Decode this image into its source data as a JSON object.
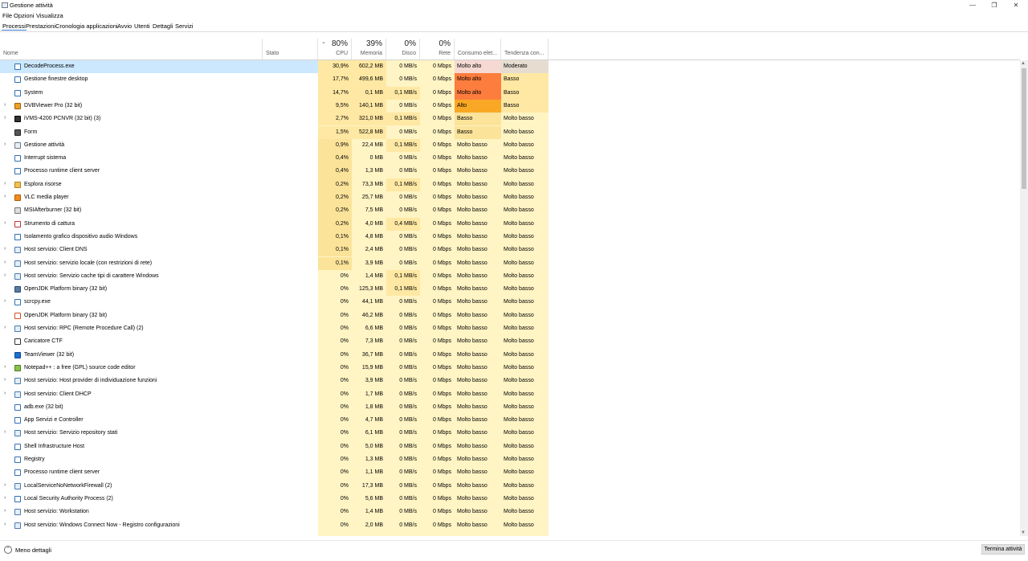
{
  "window": {
    "title": "Gestione attività",
    "minimize": "—",
    "restore": "❐",
    "close": "✕"
  },
  "menu": [
    "File",
    "Opzioni",
    "Visualizza"
  ],
  "tabs": [
    "Processi",
    "Prestazioni",
    "Cronologia applicazioni",
    "Avvio",
    "Utenti",
    "Dettagli",
    "Servizi"
  ],
  "active_tab": "Processi",
  "header": {
    "name": "Nome",
    "status": "Stato",
    "cpu": {
      "pct": "80%",
      "label": "CPU"
    },
    "memory": {
      "pct": "39%",
      "label": "Memoria"
    },
    "disk": {
      "pct": "0%",
      "label": "Disco"
    },
    "network": {
      "pct": "0%",
      "label": "Rete"
    },
    "power": "Consumo elet...",
    "trend": "Tendenza con..."
  },
  "colors": {
    "selected": "#cce8ff",
    "heat_light": "#fff4c4",
    "heat_mid": "#ffe8a3",
    "heat_hi": "#fd7d3e",
    "heat_alto": "#f9a825",
    "heat_trend": "#fbe39a",
    "moderato": "#e6ddd0"
  },
  "processes": [
    {
      "name": "DecodeProcess.exe",
      "expand": false,
      "icon": "app-window-icon",
      "cpu": "30,9%",
      "mem": "602,2 MB",
      "disk": "0 MB/s",
      "net": "0 Mbps",
      "power": "Molto alto",
      "trend": "Moderato"
    },
    {
      "name": "Gestione finestre desktop",
      "expand": false,
      "icon": "app-window-icon",
      "cpu": "17,7%",
      "mem": "499,6 MB",
      "disk": "0 MB/s",
      "net": "0 Mbps",
      "power": "Molto alto",
      "trend": "Basso"
    },
    {
      "name": "System",
      "expand": false,
      "icon": "app-window-icon",
      "cpu": "14,7%",
      "mem": "0,1 MB",
      "disk": "0,1 MB/s",
      "net": "0 Mbps",
      "power": "Molto alto",
      "trend": "Basso"
    },
    {
      "name": "DVBViewer Pro (32 bit)",
      "expand": true,
      "icon": "dvbviewer-icon",
      "cpu": "9,5%",
      "mem": "140,1 MB",
      "disk": "0 MB/s",
      "net": "0 Mbps",
      "power": "Alto",
      "trend": "Basso"
    },
    {
      "name": "iVMS-4200 PCNVR (32 bit) (3)",
      "expand": true,
      "icon": "camera-icon",
      "cpu": "2,7%",
      "mem": "321,0 MB",
      "disk": "0,1 MB/s",
      "net": "0 Mbps",
      "power": "Basso",
      "trend": "Molto basso"
    },
    {
      "name": "Form",
      "expand": false,
      "icon": "form-icon",
      "cpu": "1,5%",
      "mem": "522,8 MB",
      "disk": "0 MB/s",
      "net": "0 Mbps",
      "power": "Basso",
      "trend": "Molto basso"
    },
    {
      "name": "Gestione attività",
      "expand": true,
      "icon": "task-manager-icon",
      "cpu": "0,9%",
      "mem": "22,4 MB",
      "disk": "0,1 MB/s",
      "net": "0 Mbps",
      "power": "Molto basso",
      "trend": "Molto basso"
    },
    {
      "name": "Interrupt sistema",
      "expand": false,
      "icon": "app-window-icon",
      "cpu": "0,4%",
      "mem": "0 MB",
      "disk": "0 MB/s",
      "net": "0 Mbps",
      "power": "Molto basso",
      "trend": "Molto basso"
    },
    {
      "name": "Processo runtime client server",
      "expand": false,
      "icon": "app-window-icon",
      "cpu": "0,4%",
      "mem": "1,3 MB",
      "disk": "0 MB/s",
      "net": "0 Mbps",
      "power": "Molto basso",
      "trend": "Molto basso"
    },
    {
      "name": "Esplora risorse",
      "expand": true,
      "icon": "folder-icon",
      "cpu": "0,2%",
      "mem": "73,3 MB",
      "disk": "0,1 MB/s",
      "net": "0 Mbps",
      "power": "Molto basso",
      "trend": "Molto basso"
    },
    {
      "name": "VLC media player",
      "expand": true,
      "icon": "vlc-cone-icon",
      "cpu": "0,2%",
      "mem": "25,7 MB",
      "disk": "0 MB/s",
      "net": "0 Mbps",
      "power": "Molto basso",
      "trend": "Molto basso"
    },
    {
      "name": "MSIAfterburner (32 bit)",
      "expand": false,
      "icon": "afterburner-icon",
      "cpu": "0,2%",
      "mem": "7,5 MB",
      "disk": "0 MB/s",
      "net": "0 Mbps",
      "power": "Molto basso",
      "trend": "Molto basso"
    },
    {
      "name": "Strumento di cattura",
      "expand": true,
      "icon": "snipping-tool-icon",
      "cpu": "0,2%",
      "mem": "4,0 MB",
      "disk": "0,4 MB/s",
      "net": "0 Mbps",
      "power": "Molto basso",
      "trend": "Molto basso"
    },
    {
      "name": "Isolamento grafico dispositivo audio Windows",
      "expand": false,
      "icon": "app-window-icon",
      "cpu": "0,1%",
      "mem": "4,8 MB",
      "disk": "0 MB/s",
      "net": "0 Mbps",
      "power": "Molto basso",
      "trend": "Molto basso"
    },
    {
      "name": "Host servizio: Client DNS",
      "expand": true,
      "icon": "service-gear-icon",
      "cpu": "0,1%",
      "mem": "2,4 MB",
      "disk": "0 MB/s",
      "net": "0 Mbps",
      "power": "Molto basso",
      "trend": "Molto basso"
    },
    {
      "name": "Host servizio: servizio locale (con restrizioni di rete)",
      "expand": true,
      "icon": "service-gear-icon",
      "cpu": "0,1%",
      "mem": "3,9 MB",
      "disk": "0 MB/s",
      "net": "0 Mbps",
      "power": "Molto basso",
      "trend": "Molto basso"
    },
    {
      "name": "Host servizio: Servizio cache tipi di carattere Windows",
      "expand": true,
      "icon": "service-gear-icon",
      "cpu": "0%",
      "mem": "1,4 MB",
      "disk": "0,1 MB/s",
      "net": "0 Mbps",
      "power": "Molto basso",
      "trend": "Molto basso"
    },
    {
      "name": "OpenJDK Platform binary (32 bit)",
      "expand": false,
      "icon": "java-icon",
      "cpu": "0%",
      "mem": "125,3 MB",
      "disk": "0,1 MB/s",
      "net": "0 Mbps",
      "power": "Molto basso",
      "trend": "Molto basso"
    },
    {
      "name": "scrcpy.exe",
      "expand": true,
      "icon": "app-window-icon",
      "cpu": "0%",
      "mem": "44,1 MB",
      "disk": "0 MB/s",
      "net": "0 Mbps",
      "power": "Molto basso",
      "trend": "Molto basso"
    },
    {
      "name": "OpenJDK Platform binary (32 bit)",
      "expand": false,
      "icon": "java-cup-icon",
      "cpu": "0%",
      "mem": "46,2 MB",
      "disk": "0 MB/s",
      "net": "0 Mbps",
      "power": "Molto basso",
      "trend": "Molto basso"
    },
    {
      "name": "Host servizio: RPC (Remote Procedure Call) (2)",
      "expand": true,
      "icon": "service-gear-icon",
      "cpu": "0%",
      "mem": "6,6 MB",
      "disk": "0 MB/s",
      "net": "0 Mbps",
      "power": "Molto basso",
      "trend": "Molto basso"
    },
    {
      "name": "Caricatore CTF",
      "expand": false,
      "icon": "ctf-pen-icon",
      "cpu": "0%",
      "mem": "7,3 MB",
      "disk": "0 MB/s",
      "net": "0 Mbps",
      "power": "Molto basso",
      "trend": "Molto basso"
    },
    {
      "name": "TeamViewer (32 bit)",
      "expand": false,
      "icon": "teamviewer-icon",
      "cpu": "0%",
      "mem": "36,7 MB",
      "disk": "0 MB/s",
      "net": "0 Mbps",
      "power": "Molto basso",
      "trend": "Molto basso"
    },
    {
      "name": "Notepad++ : a free (GPL) source code editor",
      "expand": true,
      "icon": "notepadpp-icon",
      "cpu": "0%",
      "mem": "15,9 MB",
      "disk": "0 MB/s",
      "net": "0 Mbps",
      "power": "Molto basso",
      "trend": "Molto basso"
    },
    {
      "name": "Host servizio: Host provider di individuazione funzioni",
      "expand": true,
      "icon": "service-gear-icon",
      "cpu": "0%",
      "mem": "3,9 MB",
      "disk": "0 MB/s",
      "net": "0 Mbps",
      "power": "Molto basso",
      "trend": "Molto basso"
    },
    {
      "name": "Host servizio: Client DHCP",
      "expand": true,
      "icon": "service-gear-icon",
      "cpu": "0%",
      "mem": "1,7 MB",
      "disk": "0 MB/s",
      "net": "0 Mbps",
      "power": "Molto basso",
      "trend": "Molto basso"
    },
    {
      "name": "adb.exe (32 bit)",
      "expand": false,
      "icon": "app-window-icon",
      "cpu": "0%",
      "mem": "1,8 MB",
      "disk": "0 MB/s",
      "net": "0 Mbps",
      "power": "Molto basso",
      "trend": "Molto basso"
    },
    {
      "name": "App Servizi e Controller",
      "expand": false,
      "icon": "app-window-icon",
      "cpu": "0%",
      "mem": "4,7 MB",
      "disk": "0 MB/s",
      "net": "0 Mbps",
      "power": "Molto basso",
      "trend": "Molto basso"
    },
    {
      "name": "Host servizio: Servizio repository stati",
      "expand": true,
      "icon": "service-gear-icon",
      "cpu": "0%",
      "mem": "6,1 MB",
      "disk": "0 MB/s",
      "net": "0 Mbps",
      "power": "Molto basso",
      "trend": "Molto basso"
    },
    {
      "name": "Shell Infrastructure Host",
      "expand": false,
      "icon": "app-window-icon",
      "cpu": "0%",
      "mem": "5,0 MB",
      "disk": "0 MB/s",
      "net": "0 Mbps",
      "power": "Molto basso",
      "trend": "Molto basso"
    },
    {
      "name": "Registry",
      "expand": false,
      "icon": "app-window-icon",
      "cpu": "0%",
      "mem": "1,3 MB",
      "disk": "0 MB/s",
      "net": "0 Mbps",
      "power": "Molto basso",
      "trend": "Molto basso"
    },
    {
      "name": "Processo runtime client server",
      "expand": false,
      "icon": "app-window-icon",
      "cpu": "0%",
      "mem": "1,1 MB",
      "disk": "0 MB/s",
      "net": "0 Mbps",
      "power": "Molto basso",
      "trend": "Molto basso"
    },
    {
      "name": "LocalServiceNoNetworkFirewall (2)",
      "expand": true,
      "icon": "service-gear-icon",
      "cpu": "0%",
      "mem": "17,3 MB",
      "disk": "0 MB/s",
      "net": "0 Mbps",
      "power": "Molto basso",
      "trend": "Molto basso"
    },
    {
      "name": "Local Security Authority Process (2)",
      "expand": true,
      "icon": "app-window-icon",
      "cpu": "0%",
      "mem": "5,6 MB",
      "disk": "0 MB/s",
      "net": "0 Mbps",
      "power": "Molto basso",
      "trend": "Molto basso"
    },
    {
      "name": "Host servizio: Workstation",
      "expand": true,
      "icon": "service-gear-icon",
      "cpu": "0%",
      "mem": "1,4 MB",
      "disk": "0 MB/s",
      "net": "0 Mbps",
      "power": "Molto basso",
      "trend": "Molto basso"
    },
    {
      "name": "Host servizio: Windows Connect Now - Registro configurazioni",
      "expand": true,
      "icon": "service-gear-icon",
      "cpu": "0%",
      "mem": "2,0 MB",
      "disk": "0 MB/s",
      "net": "0 Mbps",
      "power": "Molto basso",
      "trend": "Molto basso"
    }
  ],
  "footer": {
    "less_details": "Meno dettagli",
    "end_task": "Termina attività"
  }
}
